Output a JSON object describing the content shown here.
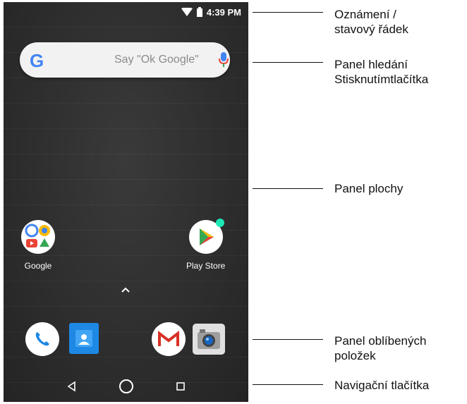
{
  "status_bar": {
    "time": "4:39 PM",
    "icons": [
      "wifi-icon",
      "battery-icon"
    ]
  },
  "search": {
    "hint": "Say \"Ok Google\"",
    "logo": "G"
  },
  "apps": [
    {
      "label": "Google",
      "icon": "google-folder-icon"
    },
    {
      "label": "Play Store",
      "icon": "play-store-icon"
    }
  ],
  "drawer_handle": "chevron-up-icon",
  "dock": [
    "phone-icon",
    "contacts-icon",
    "gmail-icon",
    "camera-icon"
  ],
  "nav": [
    "back-icon",
    "home-icon",
    "recents-icon"
  ],
  "callouts": [
    {
      "text": "Oznámení /\nstavový řádek"
    },
    {
      "text": "Panel hledání\nStisknutímtlačítka"
    },
    {
      "text": "Panel plochy"
    },
    {
      "text": "Panel oblíbených\npoložek"
    },
    {
      "text": "Navigační tlačítka"
    }
  ]
}
